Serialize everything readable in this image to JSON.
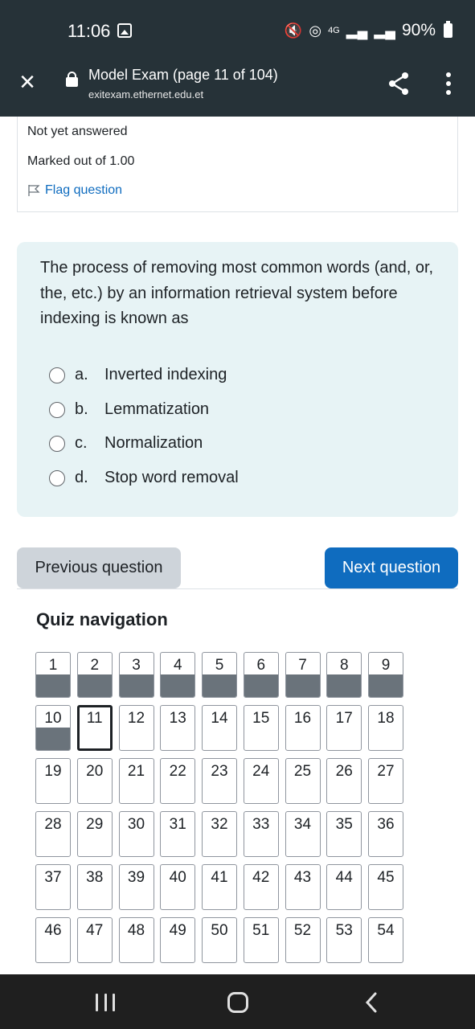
{
  "status_bar": {
    "time": "11:06",
    "network": "4G",
    "battery": "90%"
  },
  "browser": {
    "title": "Model Exam (page 11 of 104)",
    "url": "exitexam.ethernet.edu.et"
  },
  "question_info": {
    "state": "Not yet answered",
    "marks": "Marked out of 1.00",
    "flag_label": "Flag question"
  },
  "question": {
    "text": "The process of removing most common words (and, or, the, etc.) by an information retrieval system before indexing is known as",
    "answers": [
      {
        "letter": "a.",
        "text": "Inverted indexing"
      },
      {
        "letter": "b.",
        "text": "Lemmatization"
      },
      {
        "letter": "c.",
        "text": "Normalization"
      },
      {
        "letter": "d.",
        "text": "Stop word removal"
      }
    ]
  },
  "buttons": {
    "previous": "Previous question",
    "next": "Next question"
  },
  "quiz_nav": {
    "title": "Quiz navigation",
    "current": 11,
    "answered": [
      1,
      2,
      3,
      4,
      5,
      6,
      7,
      8,
      9,
      10
    ],
    "numbers": [
      1,
      2,
      3,
      4,
      5,
      6,
      7,
      8,
      9,
      10,
      11,
      12,
      13,
      14,
      15,
      16,
      17,
      18,
      19,
      20,
      21,
      22,
      23,
      24,
      25,
      26,
      27,
      28,
      29,
      30,
      31,
      32,
      33,
      34,
      35,
      36,
      37,
      38,
      39,
      40,
      41,
      42,
      43,
      44,
      45,
      46,
      47,
      48,
      49,
      50,
      51,
      52,
      53,
      54
    ]
  },
  "colors": {
    "header_bg": "#263238",
    "question_bg": "#e7f3f5",
    "primary": "#0f6cbf",
    "answered_fill": "#6a737b"
  }
}
